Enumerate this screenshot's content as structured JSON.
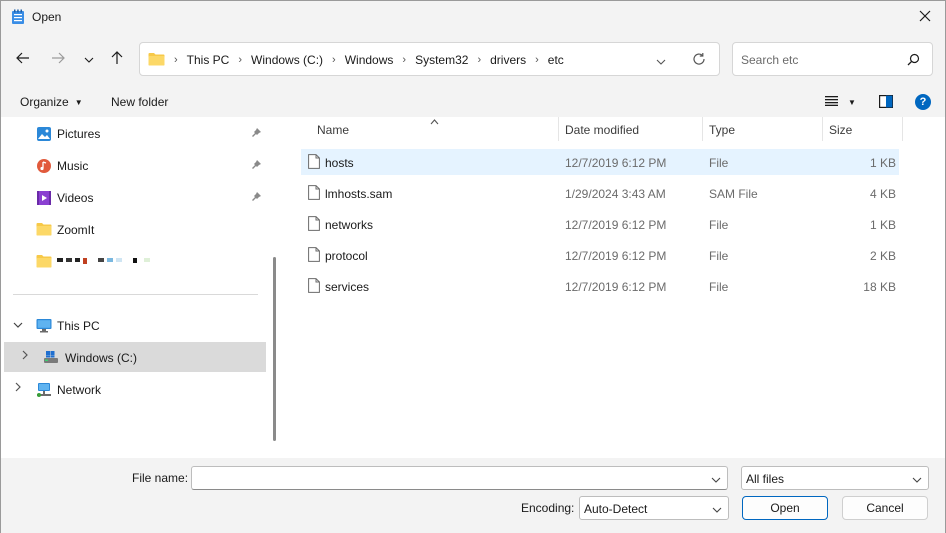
{
  "window": {
    "title": "Open"
  },
  "address": {
    "crumbs": [
      "This PC",
      "Windows (C:)",
      "Windows",
      "System32",
      "drivers",
      "etc"
    ]
  },
  "search": {
    "placeholder": "Search etc"
  },
  "toolbar": {
    "organize_label": "Organize",
    "new_folder_label": "New folder"
  },
  "sidebar": {
    "quick_access": [
      {
        "label": "Pictures",
        "icon": "pictures-icon",
        "pinned": true
      },
      {
        "label": "Music",
        "icon": "music-icon",
        "pinned": true
      },
      {
        "label": "Videos",
        "icon": "videos-icon",
        "pinned": true
      },
      {
        "label": "ZoomIt",
        "icon": "folder-icon",
        "pinned": false
      }
    ],
    "this_pc": "This PC",
    "windows_drive": "Windows (C:)",
    "network": "Network"
  },
  "columns": {
    "name": "Name",
    "date": "Date modified",
    "type": "Type",
    "size": "Size"
  },
  "files": [
    {
      "name": "hosts",
      "date": "12/7/2019 6:12 PM",
      "type": "File",
      "size": "1 KB"
    },
    {
      "name": "lmhosts.sam",
      "date": "1/29/2024 3:43 AM",
      "type": "SAM File",
      "size": "4 KB"
    },
    {
      "name": "networks",
      "date": "12/7/2019 6:12 PM",
      "type": "File",
      "size": "1 KB"
    },
    {
      "name": "protocol",
      "date": "12/7/2019 6:12 PM",
      "type": "File",
      "size": "2 KB"
    },
    {
      "name": "services",
      "date": "12/7/2019 6:12 PM",
      "type": "File",
      "size": "18 KB"
    }
  ],
  "footer": {
    "file_name_label": "File name:",
    "file_name_value": "",
    "filter_value": "All files",
    "encoding_label": "Encoding:",
    "encoding_value": "Auto-Detect",
    "open_label": "Open",
    "cancel_label": "Cancel"
  },
  "colors": {
    "accent": "#0067c0",
    "selection": "#dadada",
    "hover": "#e5f3ff",
    "chrome": "#f3f3f3"
  }
}
